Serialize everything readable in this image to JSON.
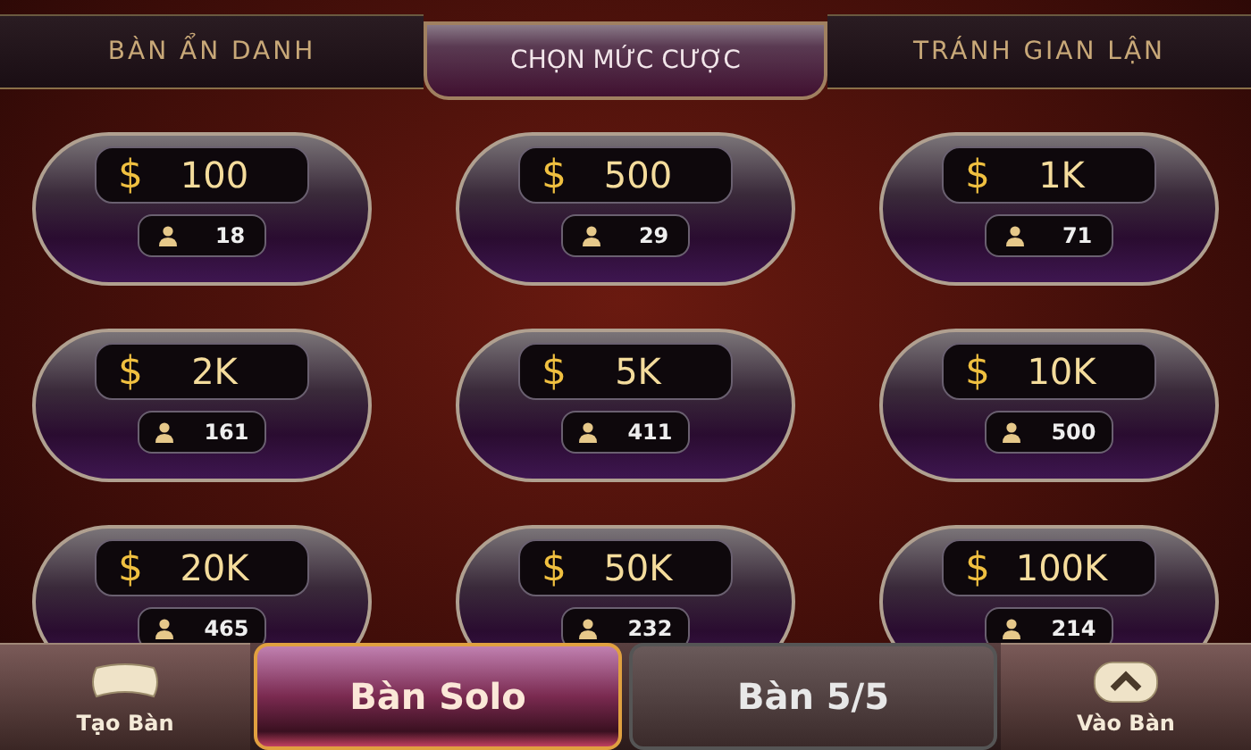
{
  "tabs": [
    {
      "label": "BÀN ẨN DANH",
      "selected": false
    },
    {
      "label": "CHỌN MỨC CƯỢC",
      "selected": true
    },
    {
      "label": "TRÁNH GIAN LẬN",
      "selected": false
    }
  ],
  "tables": [
    {
      "currency": "$",
      "bet": "100",
      "players": "18"
    },
    {
      "currency": "$",
      "bet": "500",
      "players": "29"
    },
    {
      "currency": "$",
      "bet": "1K",
      "players": "71"
    },
    {
      "currency": "$",
      "bet": "2K",
      "players": "161"
    },
    {
      "currency": "$",
      "bet": "5K",
      "players": "411"
    },
    {
      "currency": "$",
      "bet": "10K",
      "players": "500"
    },
    {
      "currency": "$",
      "bet": "20K",
      "players": "465"
    },
    {
      "currency": "$",
      "bet": "50K",
      "players": "232"
    },
    {
      "currency": "$",
      "bet": "100K",
      "players": "214"
    }
  ],
  "create_button": {
    "label": "Tạo Bàn"
  },
  "modes": [
    {
      "label": "Bàn Solo",
      "selected": true
    },
    {
      "label": "Bàn 5/5",
      "selected": false
    }
  ],
  "join_button": {
    "label": "Vào Bàn"
  }
}
